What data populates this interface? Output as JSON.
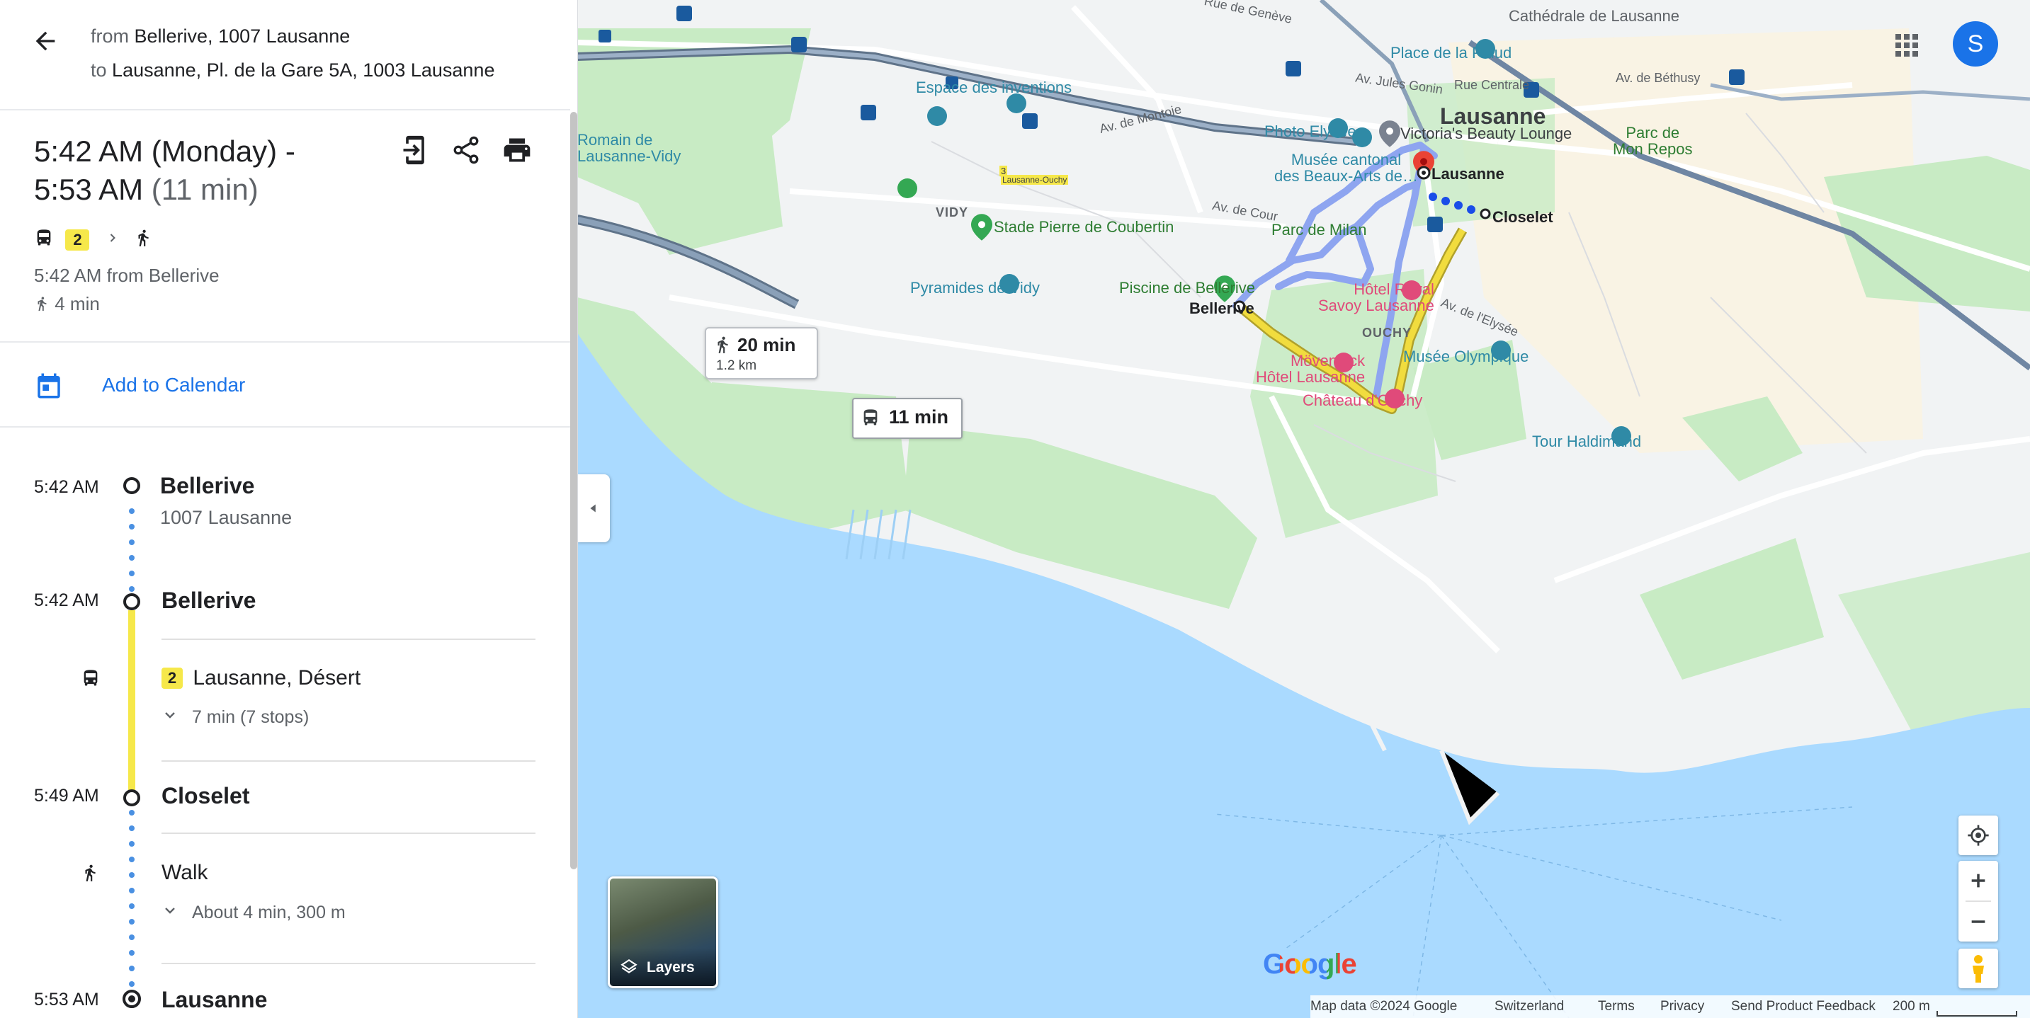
{
  "header": {
    "from_prefix": "from",
    "from_value": "Bellerive, 1007 Lausanne",
    "to_prefix": "to",
    "to_value": "Lausanne, Pl. de la Gare 5A, 1003 Lausanne"
  },
  "summary": {
    "time_line1": "5:42 AM (Monday) -",
    "time_line2": "5:53 AM",
    "duration": "(11 min)",
    "bus_line": "2",
    "depart_text": "5:42 AM from Bellerive",
    "walk_text": "4 min"
  },
  "calendar": {
    "label": "Add to Calendar"
  },
  "steps": {
    "s1_time": "5:42 AM",
    "s1_name": "Bellerive",
    "s1_sub": "1007 Lausanne",
    "s2_time": "5:42 AM",
    "s2_name": "Bellerive",
    "bus_badge": "2",
    "bus_dest": "Lausanne, Désert",
    "bus_stops": "7 min (7 stops)",
    "s3_time": "5:49 AM",
    "s3_name": "Closelet",
    "walk_label": "Walk",
    "walk_detail": "About 4 min, 300 m",
    "s4_time": "5:53 AM",
    "s4_name": "Lausanne"
  },
  "map": {
    "labels": {
      "cathedrale": "Cathédrale de Lausanne",
      "palud": "Place de la Palud",
      "rue_centrale": "Rue Centrale",
      "av_bethusy": "Av. de Béthusy",
      "av_jules": "Av. Jules Gonin",
      "lausanne_city": "Lausanne",
      "espace": "Espace des inventions",
      "montoie": "Av. de Montoie",
      "photo": "Photo Elysée",
      "victoria": "Victoria's Beauty Lounge",
      "parc_mon_repos": "Parc de\nMon Repos",
      "musee_cantonal": "Musée cantonal\ndes Beaux-Arts de…",
      "lausanne_dest": "Lausanne",
      "romain": "Romain de\nLausanne-Vidy",
      "metro_stop": "Lausanne-Ouchy",
      "metro_num": "3",
      "vidy": "VIDY",
      "av_cour": "Av. de Cour",
      "closelet": "Closelet",
      "stade": "Stade Pierre de Coubertin",
      "parc_milan": "Parc de Milan",
      "pyramides": "Pyramides de Vidy",
      "piscine": "Piscine de Bellerive",
      "bellerive": "Bellerive",
      "hotel_royal": "Hôtel Royal\nSavoy Lausanne",
      "av_elysee": "Av. de l'Elysée",
      "ouchy": "OUCHY",
      "olympique": "Musée Olympique",
      "movenpick": "Mövenpick\nHôtel Lausanne",
      "chateau": "Château d'Ouchy",
      "haldimand": "Tour Haldimand",
      "rue_geneve": "Rue de Genève",
      "google": "Google"
    },
    "walk_time": "20 min",
    "walk_dist": "1.2 km",
    "bus_time": "11 min",
    "layers": "Layers",
    "avatar_letter": "S",
    "footer": {
      "mapdata": "Map data ©2024 Google",
      "country": "Switzerland",
      "terms": "Terms",
      "privacy": "Privacy",
      "feedback": "Send Product Feedback",
      "scale": "200 m"
    },
    "colors": {
      "water": "#aadaff",
      "park": "#c8ebc4",
      "bus": "#f1dc3e",
      "route_alt": "#8ea5f0",
      "walk": "#1a4de8"
    }
  }
}
